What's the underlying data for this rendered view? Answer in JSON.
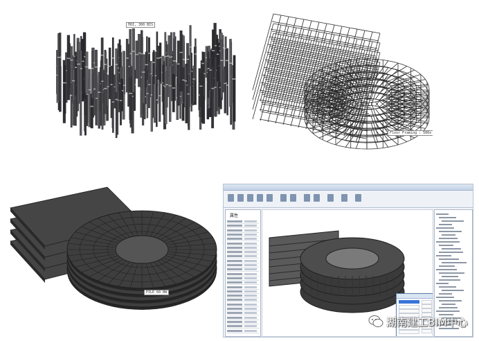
{
  "panels": {
    "pile_model": {
      "tag": "ПОІ, 300 BIS"
    },
    "frame_model": {
      "tag": "Floor Framing : 500x"
    },
    "slab_model": {
      "tag": "PILE 60 BW"
    }
  },
  "revit_window": {
    "properties_title": "属性"
  },
  "watermark": {
    "text": "湖南建工BIM中心",
    "icon": "wechat-icon",
    "color": "#ffffff"
  },
  "colors": {
    "structure_dark": "#3c3c3c",
    "wire": "#2a2a2a",
    "selection": "#3875d7"
  }
}
